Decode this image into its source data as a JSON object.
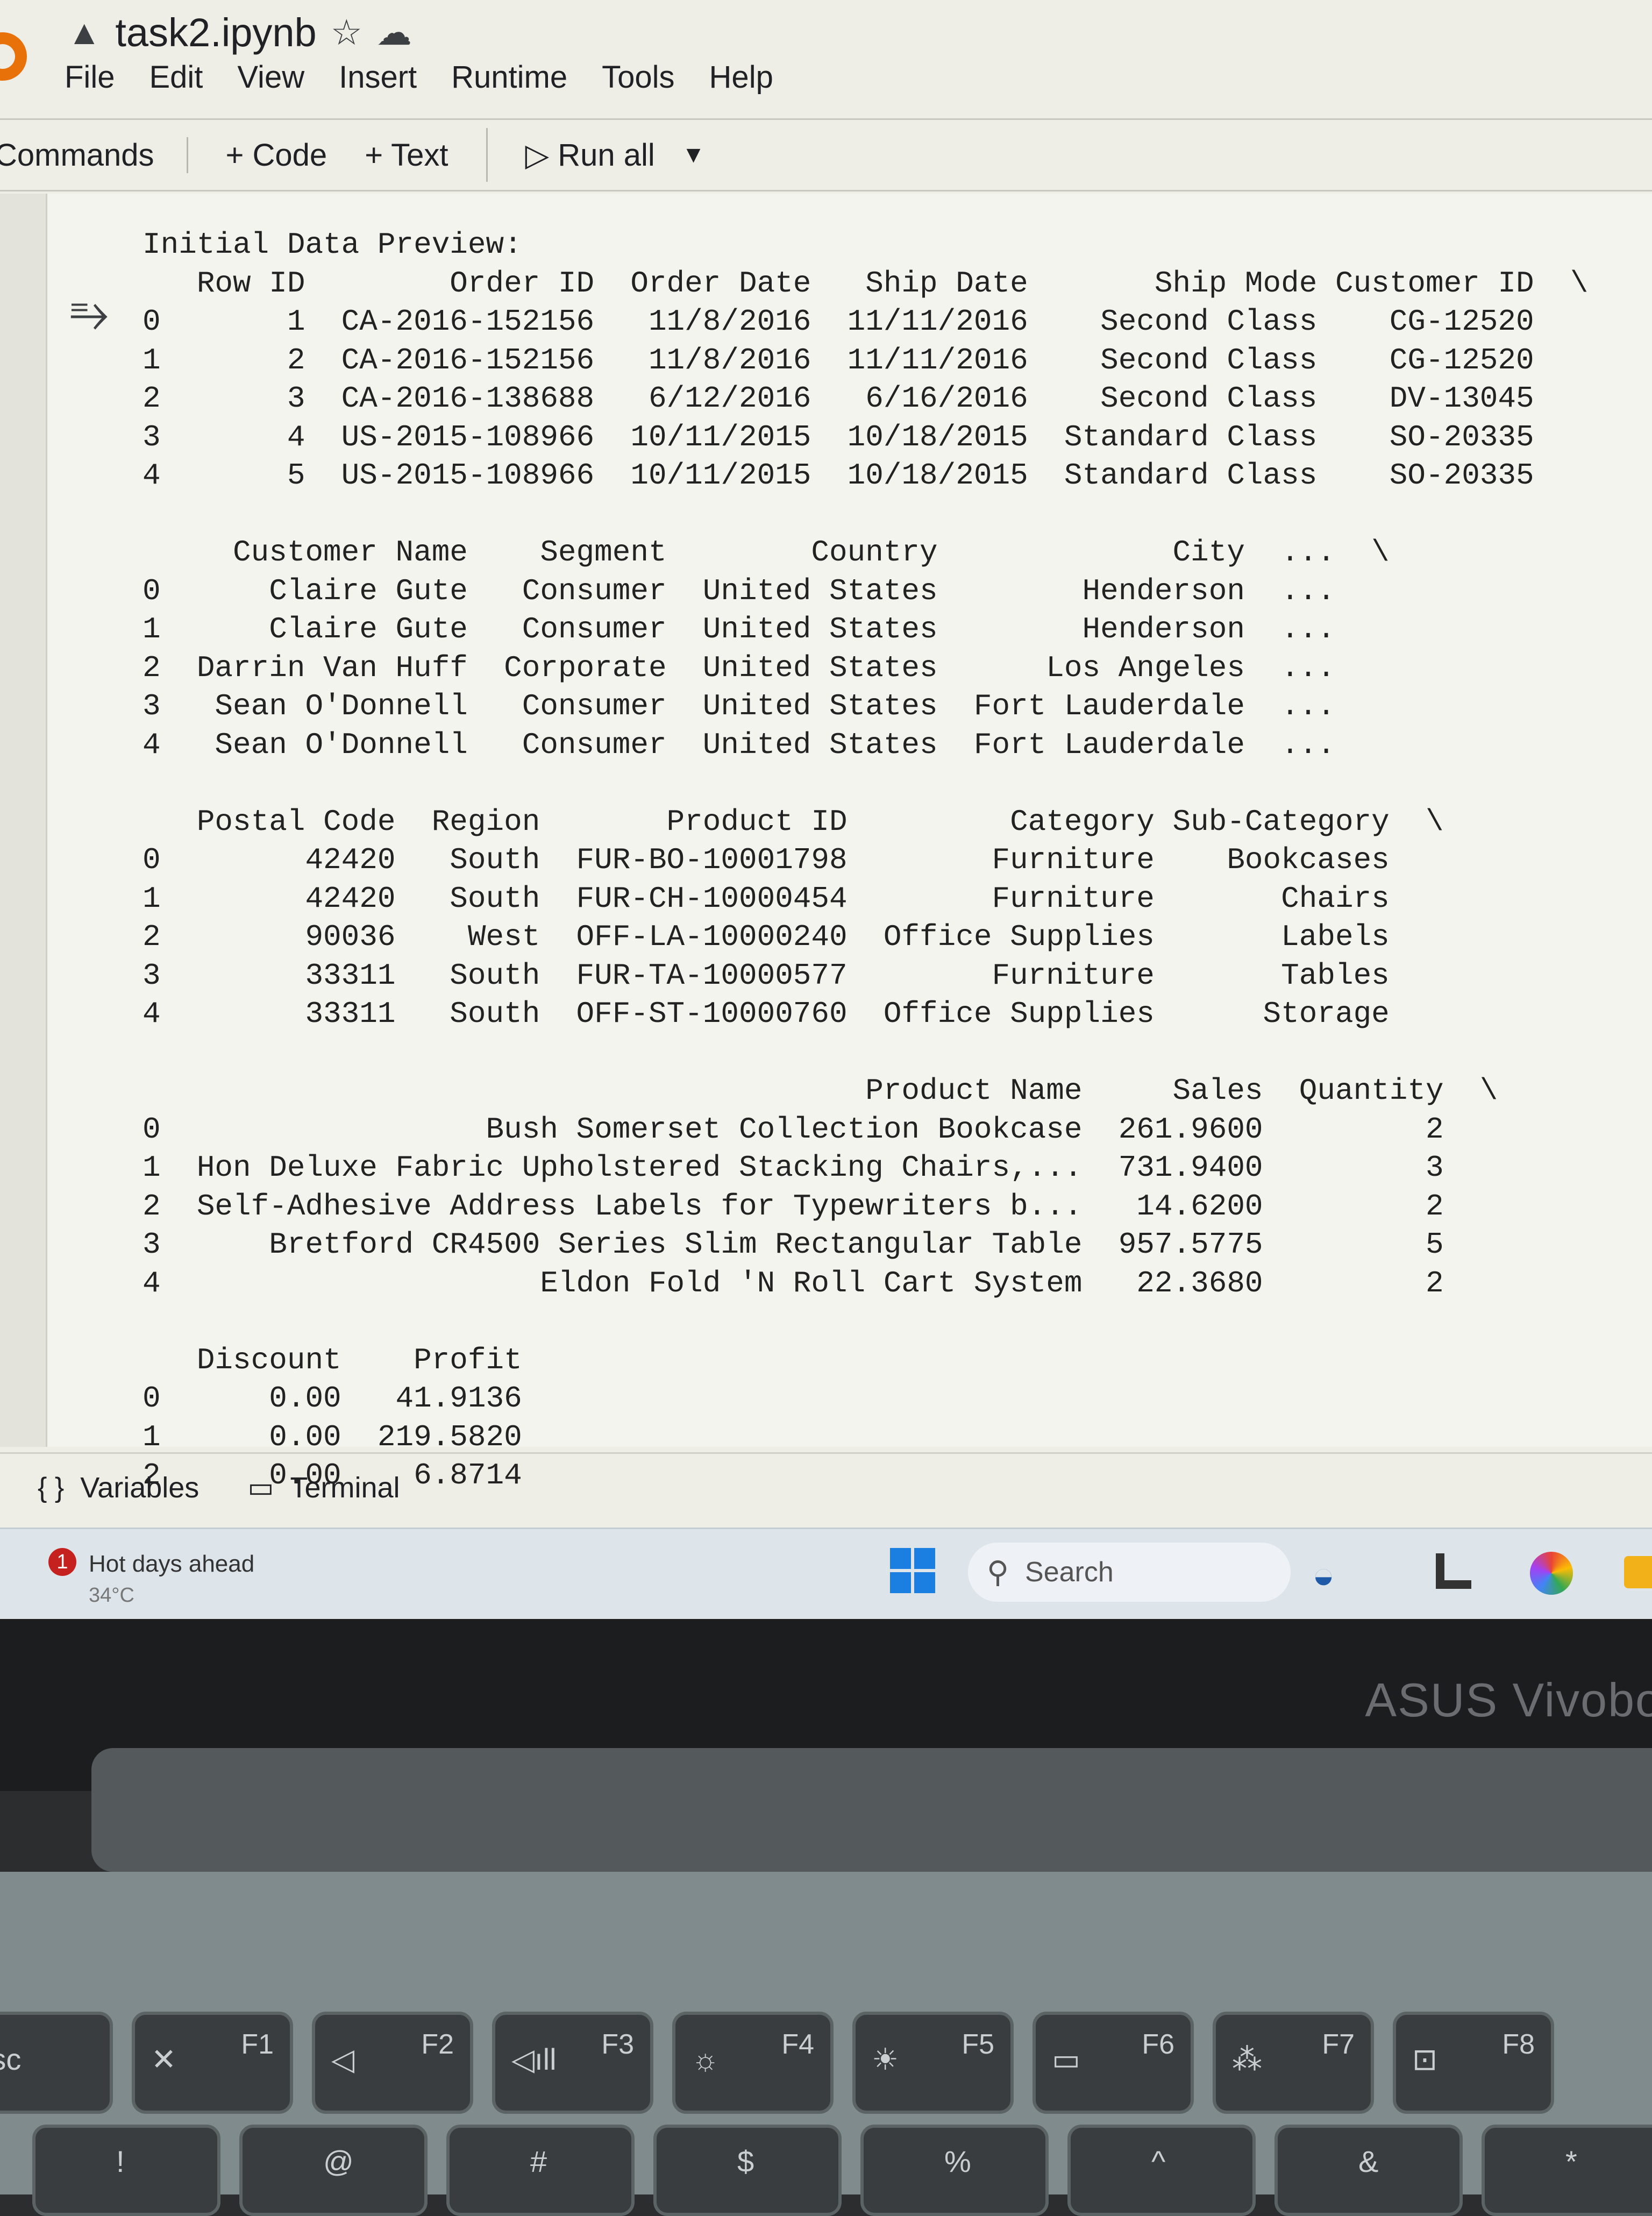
{
  "notebook": {
    "drive_icon": "drive-logo-icon",
    "filename": "task2.ipynb",
    "star_icon": "☆",
    "cloud_icon": "☁"
  },
  "menu": [
    "File",
    "Edit",
    "View",
    "Insert",
    "Runtime",
    "Tools",
    "Help"
  ],
  "toolbar": {
    "commands": "Commands",
    "add_code": "+ Code",
    "add_text": "+ Text",
    "run_all": "▷ Run all",
    "run_menu": "▼"
  },
  "output_icon": "⥱",
  "output_lines": [
    "Initial Data Preview:",
    "   Row ID        Order ID  Order Date   Ship Date       Ship Mode Customer ID  \\",
    "0       1  CA-2016-152156   11/8/2016  11/11/2016    Second Class    CG-12520",
    "1       2  CA-2016-152156   11/8/2016  11/11/2016    Second Class    CG-12520",
    "2       3  CA-2016-138688   6/12/2016   6/16/2016    Second Class    DV-13045",
    "3       4  US-2015-108966  10/11/2015  10/18/2015  Standard Class    SO-20335",
    "4       5  US-2015-108966  10/11/2015  10/18/2015  Standard Class    SO-20335",
    "",
    "     Customer Name    Segment        Country             City  ...  \\",
    "0      Claire Gute   Consumer  United States        Henderson  ...",
    "1      Claire Gute   Consumer  United States        Henderson  ...",
    "2  Darrin Van Huff  Corporate  United States      Los Angeles  ...",
    "3   Sean O'Donnell   Consumer  United States  Fort Lauderdale  ...",
    "4   Sean O'Donnell   Consumer  United States  Fort Lauderdale  ...",
    "",
    "   Postal Code  Region       Product ID         Category Sub-Category  \\",
    "0        42420   South  FUR-BO-10001798        Furniture    Bookcases",
    "1        42420   South  FUR-CH-10000454        Furniture       Chairs",
    "2        90036    West  OFF-LA-10000240  Office Supplies       Labels",
    "3        33311   South  FUR-TA-10000577        Furniture       Tables",
    "4        33311   South  OFF-ST-10000760  Office Supplies      Storage",
    "",
    "                                        Product Name     Sales  Quantity  \\",
    "0                  Bush Somerset Collection Bookcase  261.9600         2",
    "1  Hon Deluxe Fabric Upholstered Stacking Chairs,...  731.9400         3",
    "2  Self-Adhesive Address Labels for Typewriters b...   14.6200         2",
    "3      Bretford CR4500 Series Slim Rectangular Table  957.5775         5",
    "4                     Eldon Fold 'N Roll Cart System   22.3680         2",
    "",
    "   Discount    Profit",
    "0      0.00   41.9136",
    "1      0.00  219.5820",
    "2      0.00    6.8714"
  ],
  "bottom_panel": {
    "variables": "Variables",
    "variables_icon": "{ }",
    "terminal": "Terminal",
    "terminal_icon": "▭"
  },
  "taskbar": {
    "weather_title": "Hot days ahead",
    "weather_temp": "34°C",
    "weather_badge": "1",
    "search_placeholder": "Search",
    "search_icon": "⚲"
  },
  "laptop": {
    "brand": "ASUS Vivobo",
    "fn_keys": [
      {
        "main": "Esc",
        "fn": ""
      },
      {
        "main": "✕",
        "fn": "F1"
      },
      {
        "main": "◁",
        "fn": "F2"
      },
      {
        "main": "◁ıll",
        "fn": "F3"
      },
      {
        "main": "☼",
        "fn": "F4"
      },
      {
        "main": "☀",
        "fn": "F5"
      },
      {
        "main": "▭",
        "fn": "F6"
      },
      {
        "main": "⁂",
        "fn": "F7"
      },
      {
        "main": "⊡",
        "fn": "F8"
      }
    ],
    "number_keys": [
      "!",
      "@",
      "#",
      "$",
      "%",
      "^",
      "&",
      "*"
    ]
  }
}
